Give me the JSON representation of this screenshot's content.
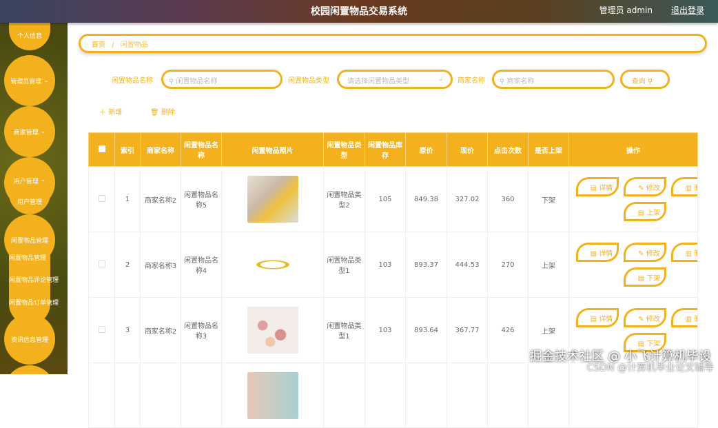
{
  "header": {
    "title": "校园闲置物品交易系统",
    "user": "管理员 admin",
    "logout": "退出登录"
  },
  "sidebar": {
    "items": [
      "个人信息",
      "管理员管理",
      "商家管理",
      "用户管理",
      "用户管理",
      "闲置物品管理",
      "闲置物品管理",
      "闲置物品评论管理",
      "闲置物品订单管理",
      "资讯信息管理"
    ]
  },
  "breadcrumb": {
    "home": "首页",
    "sep": "/",
    "current": "闲置物品"
  },
  "search": {
    "name_label": "闲置物品名称",
    "name_placeholder": "闲置物品名称",
    "type_label": "闲置物品类型",
    "type_placeholder": "请选择闲置物品类型",
    "merchant_label": "商家名称",
    "merchant_placeholder": "商家名称",
    "query": "查询"
  },
  "toolbar": {
    "add": "新增",
    "delete": "删除"
  },
  "table": {
    "headers": [
      "索引",
      "商家名称",
      "闲置物品名称",
      "闲置物品照片",
      "闲置物品类型",
      "闲置物品库存",
      "原价",
      "现价",
      "点击次数",
      "是否上架",
      "操作"
    ],
    "rows": [
      {
        "idx": "1",
        "merchant": "商家名称2",
        "name": "闲置物品名称5",
        "type": "闲置物品类型2",
        "stock": "105",
        "orig": "849.38",
        "price": "327.02",
        "clicks": "360",
        "status": "下架",
        "toggle": "上架"
      },
      {
        "idx": "2",
        "merchant": "商家名称3",
        "name": "闲置物品名称4",
        "type": "闲置物品类型1",
        "stock": "103",
        "orig": "893.37",
        "price": "444.53",
        "clicks": "270",
        "status": "上架",
        "toggle": "下架"
      },
      {
        "idx": "3",
        "merchant": "商家名称2",
        "name": "闲置物品名称3",
        "type": "闲置物品类型1",
        "stock": "103",
        "orig": "893.64",
        "price": "367.77",
        "clicks": "426",
        "status": "上架",
        "toggle": "下架"
      }
    ],
    "actions": {
      "detail": "详情",
      "edit": "修改",
      "delete": "删除"
    }
  },
  "watermark": {
    "main": "掘金技术社区 @ 小飞计算机毕设",
    "sub": "CSDN @计算机毕业论文辅导"
  }
}
